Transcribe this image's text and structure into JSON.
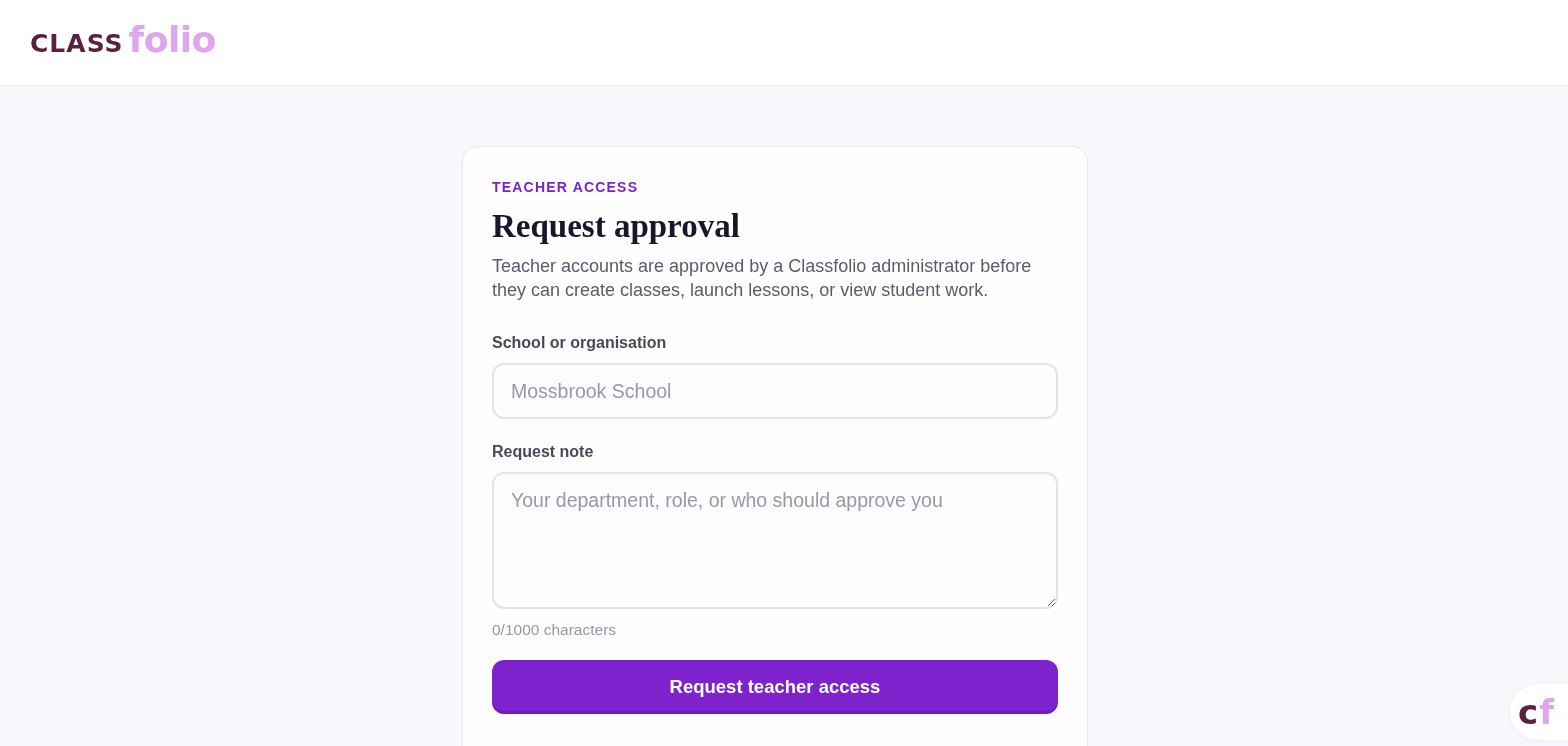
{
  "header": {
    "logo": [
      {
        "text": "CLASS",
        "color": "#5b1f40"
      },
      {
        "text": "folio",
        "color": "#dfa6f0"
      }
    ]
  },
  "card": {
    "eyebrow": "TEACHER ACCESS",
    "title": "Request approval",
    "description": "Teacher accounts are approved by a Classfolio administrator before they can create classes, launch lessons, or view student work.",
    "fields": [
      {
        "kind": "input",
        "label": "School or organisation",
        "placeholder": "Mossbrook School"
      },
      {
        "kind": "textarea",
        "label": "Request note",
        "placeholder": "Your department, role, or who should approve you",
        "counter": "0/1000 characters"
      }
    ],
    "submit_button": "Request teacher access"
  },
  "floating_badge": [
    {
      "text": "c",
      "color": "#5b1f40"
    },
    {
      "text": "f",
      "color": "#dfa6f0"
    }
  ]
}
